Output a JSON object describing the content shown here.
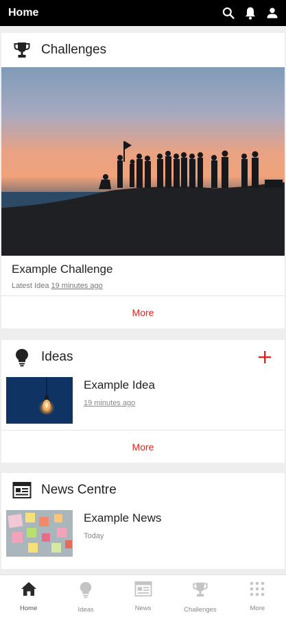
{
  "header": {
    "title": "Home",
    "icons": [
      "search-icon",
      "bell-icon",
      "profile-icon"
    ]
  },
  "challenges": {
    "title": "Challenges",
    "icon": "trophy-icon",
    "item_title": "Example Challenge",
    "meta_prefix": "Latest Idea",
    "meta_time": "19 minutes ago",
    "more_label": "More"
  },
  "ideas": {
    "title": "Ideas",
    "icon": "lightbulb-icon",
    "add_icon": "plus-icon",
    "item_title": "Example Idea",
    "item_time": "19 minutes ago",
    "more_label": "More"
  },
  "news": {
    "title": "News Centre",
    "icon": "newspaper-icon",
    "item_title": "Example News",
    "item_time": "Today"
  },
  "bottom_nav": [
    {
      "label": "Home",
      "icon": "home-icon",
      "active": true
    },
    {
      "label": "Ideas",
      "icon": "lightbulb-icon",
      "active": false
    },
    {
      "label": "News",
      "icon": "newspaper-icon",
      "active": false
    },
    {
      "label": "Challenges",
      "icon": "trophy-icon",
      "active": false
    },
    {
      "label": "More",
      "icon": "grid-icon",
      "active": false
    }
  ],
  "colors": {
    "accent": "#e0231f",
    "topbar": "#000000",
    "background": "#eeeeee"
  }
}
